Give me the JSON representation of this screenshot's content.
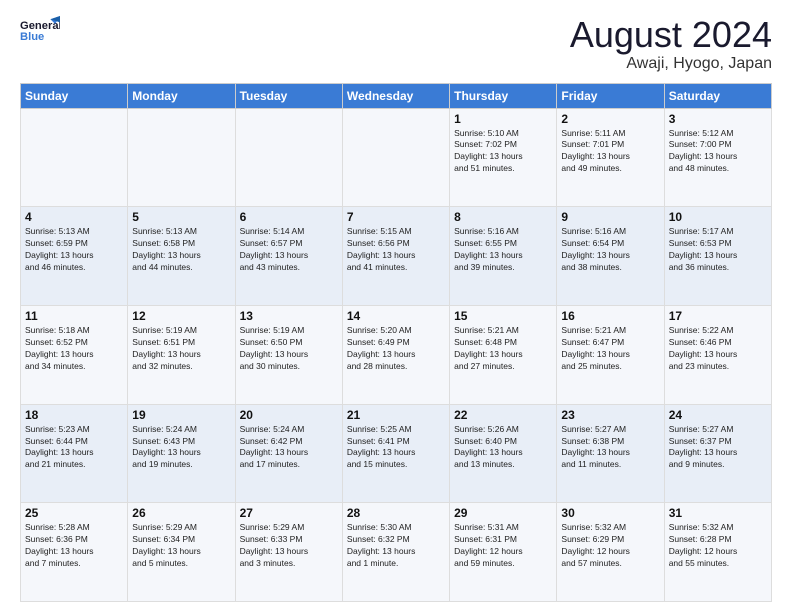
{
  "header": {
    "logo_general": "General",
    "logo_blue": "Blue",
    "month_title": "August 2024",
    "location": "Awaji, Hyogo, Japan"
  },
  "days_of_week": [
    "Sunday",
    "Monday",
    "Tuesday",
    "Wednesday",
    "Thursday",
    "Friday",
    "Saturday"
  ],
  "weeks": [
    [
      {
        "day": "",
        "info": ""
      },
      {
        "day": "",
        "info": ""
      },
      {
        "day": "",
        "info": ""
      },
      {
        "day": "",
        "info": ""
      },
      {
        "day": "1",
        "info": "Sunrise: 5:10 AM\nSunset: 7:02 PM\nDaylight: 13 hours\nand 51 minutes."
      },
      {
        "day": "2",
        "info": "Sunrise: 5:11 AM\nSunset: 7:01 PM\nDaylight: 13 hours\nand 49 minutes."
      },
      {
        "day": "3",
        "info": "Sunrise: 5:12 AM\nSunset: 7:00 PM\nDaylight: 13 hours\nand 48 minutes."
      }
    ],
    [
      {
        "day": "4",
        "info": "Sunrise: 5:13 AM\nSunset: 6:59 PM\nDaylight: 13 hours\nand 46 minutes."
      },
      {
        "day": "5",
        "info": "Sunrise: 5:13 AM\nSunset: 6:58 PM\nDaylight: 13 hours\nand 44 minutes."
      },
      {
        "day": "6",
        "info": "Sunrise: 5:14 AM\nSunset: 6:57 PM\nDaylight: 13 hours\nand 43 minutes."
      },
      {
        "day": "7",
        "info": "Sunrise: 5:15 AM\nSunset: 6:56 PM\nDaylight: 13 hours\nand 41 minutes."
      },
      {
        "day": "8",
        "info": "Sunrise: 5:16 AM\nSunset: 6:55 PM\nDaylight: 13 hours\nand 39 minutes."
      },
      {
        "day": "9",
        "info": "Sunrise: 5:16 AM\nSunset: 6:54 PM\nDaylight: 13 hours\nand 38 minutes."
      },
      {
        "day": "10",
        "info": "Sunrise: 5:17 AM\nSunset: 6:53 PM\nDaylight: 13 hours\nand 36 minutes."
      }
    ],
    [
      {
        "day": "11",
        "info": "Sunrise: 5:18 AM\nSunset: 6:52 PM\nDaylight: 13 hours\nand 34 minutes."
      },
      {
        "day": "12",
        "info": "Sunrise: 5:19 AM\nSunset: 6:51 PM\nDaylight: 13 hours\nand 32 minutes."
      },
      {
        "day": "13",
        "info": "Sunrise: 5:19 AM\nSunset: 6:50 PM\nDaylight: 13 hours\nand 30 minutes."
      },
      {
        "day": "14",
        "info": "Sunrise: 5:20 AM\nSunset: 6:49 PM\nDaylight: 13 hours\nand 28 minutes."
      },
      {
        "day": "15",
        "info": "Sunrise: 5:21 AM\nSunset: 6:48 PM\nDaylight: 13 hours\nand 27 minutes."
      },
      {
        "day": "16",
        "info": "Sunrise: 5:21 AM\nSunset: 6:47 PM\nDaylight: 13 hours\nand 25 minutes."
      },
      {
        "day": "17",
        "info": "Sunrise: 5:22 AM\nSunset: 6:46 PM\nDaylight: 13 hours\nand 23 minutes."
      }
    ],
    [
      {
        "day": "18",
        "info": "Sunrise: 5:23 AM\nSunset: 6:44 PM\nDaylight: 13 hours\nand 21 minutes."
      },
      {
        "day": "19",
        "info": "Sunrise: 5:24 AM\nSunset: 6:43 PM\nDaylight: 13 hours\nand 19 minutes."
      },
      {
        "day": "20",
        "info": "Sunrise: 5:24 AM\nSunset: 6:42 PM\nDaylight: 13 hours\nand 17 minutes."
      },
      {
        "day": "21",
        "info": "Sunrise: 5:25 AM\nSunset: 6:41 PM\nDaylight: 13 hours\nand 15 minutes."
      },
      {
        "day": "22",
        "info": "Sunrise: 5:26 AM\nSunset: 6:40 PM\nDaylight: 13 hours\nand 13 minutes."
      },
      {
        "day": "23",
        "info": "Sunrise: 5:27 AM\nSunset: 6:38 PM\nDaylight: 13 hours\nand 11 minutes."
      },
      {
        "day": "24",
        "info": "Sunrise: 5:27 AM\nSunset: 6:37 PM\nDaylight: 13 hours\nand 9 minutes."
      }
    ],
    [
      {
        "day": "25",
        "info": "Sunrise: 5:28 AM\nSunset: 6:36 PM\nDaylight: 13 hours\nand 7 minutes."
      },
      {
        "day": "26",
        "info": "Sunrise: 5:29 AM\nSunset: 6:34 PM\nDaylight: 13 hours\nand 5 minutes."
      },
      {
        "day": "27",
        "info": "Sunrise: 5:29 AM\nSunset: 6:33 PM\nDaylight: 13 hours\nand 3 minutes."
      },
      {
        "day": "28",
        "info": "Sunrise: 5:30 AM\nSunset: 6:32 PM\nDaylight: 13 hours\nand 1 minute."
      },
      {
        "day": "29",
        "info": "Sunrise: 5:31 AM\nSunset: 6:31 PM\nDaylight: 12 hours\nand 59 minutes."
      },
      {
        "day": "30",
        "info": "Sunrise: 5:32 AM\nSunset: 6:29 PM\nDaylight: 12 hours\nand 57 minutes."
      },
      {
        "day": "31",
        "info": "Sunrise: 5:32 AM\nSunset: 6:28 PM\nDaylight: 12 hours\nand 55 minutes."
      }
    ]
  ]
}
